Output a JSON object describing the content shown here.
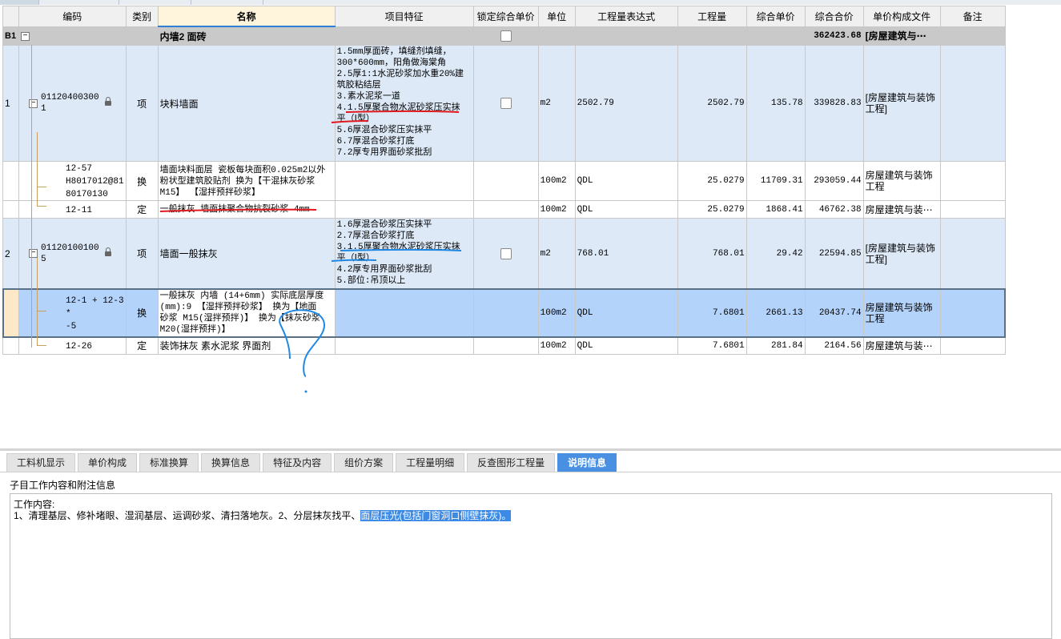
{
  "columns": {
    "code": "编码",
    "type": "类别",
    "name": "名称",
    "feature": "项目特征",
    "lock": "锁定综合单价",
    "unit": "单位",
    "expr": "工程量表达式",
    "qty": "工程量",
    "unit_price": "综合单价",
    "total": "综合合价",
    "file": "单价构成文件",
    "remark": "备注"
  },
  "group": {
    "id": "B1",
    "name": "内墙2  面砖",
    "total": "362423.68",
    "file": "[房屋建筑与⋯"
  },
  "row1": {
    "index": "1",
    "code_l1": "01120400300",
    "code_l2": "1",
    "type": "项",
    "name": "块料墙面",
    "feature": [
      "1.5mm厚面砖，填缝剂填缝，",
      "300*600mm，阳角做海棠角",
      "2.5厚1:1水泥砂浆加水重20%建",
      "筑胶粘结层",
      "3.素水泥浆一道",
      "4.1.5厚聚合物水泥砂浆压实抹",
      "平（Ⅰ型）",
      "5.6厚混合砂浆压实抹平",
      "6.7厚混合砂浆打底",
      "7.2厚专用界面砂浆批刮"
    ],
    "unit": "m2",
    "expr": "2502.79",
    "qty": "2502.79",
    "unit_price": "135.78",
    "total": "339828.83",
    "file_l1": "[房屋建筑与装饰",
    "file_l2": "工程]"
  },
  "row1a": {
    "code_l1": "12-57",
    "code_l2": "H8017012@81",
    "code_l3": "80170130",
    "type": "换",
    "name_l1": "墙面块料面层 瓷板每块面积0.025m2以外",
    "name_l2": "粉状型建筑胶贴剂  换为【干混抹灰砂浆",
    "name_l3": "M15】  【湿拌预拌砂浆】",
    "unit": "100m2",
    "expr": "QDL",
    "qty": "25.0279",
    "unit_price": "11709.31",
    "total": "293059.44",
    "file_l1": "房屋建筑与装饰",
    "file_l2": "工程"
  },
  "row1b": {
    "code": "12-11",
    "type": "定",
    "name": "一般抹灰 墙面抹聚合物抗裂砂浆 4mm",
    "unit": "100m2",
    "expr": "QDL",
    "qty": "25.0279",
    "unit_price": "1868.41",
    "total": "46762.38",
    "file": "房屋建筑与装⋯"
  },
  "row2": {
    "index": "2",
    "code_l1": "01120100100",
    "code_l2": "5",
    "type": "项",
    "name": "墙面一般抹灰",
    "feature": [
      "1.6厚混合砂浆压实抹平",
      "2.7厚混合砂浆打底",
      "3.1.5厚聚合物水泥砂浆压实抹",
      "平（Ⅰ型）",
      "4.2厚专用界面砂浆批刮",
      "5.部位:吊顶以上"
    ],
    "unit": "m2",
    "expr": "768.01",
    "qty": "768.01",
    "unit_price": "29.42",
    "total": "22594.85",
    "file_l1": "[房屋建筑与装饰",
    "file_l2": "工程]"
  },
  "row2a": {
    "code_l1": "12-1 + 12-3 *",
    "code_l2": "-5",
    "type": "换",
    "name_l1": "一般抹灰 内墙 (14+6mm)  实际底层厚度",
    "name_l2": "(mm):9  【湿拌预拌砂浆】  换为【地面",
    "name_l3": "砂浆 M15(湿拌预拌)】  换为【抹灰砂浆",
    "name_l4": "M20(湿拌预拌)】",
    "unit": "100m2",
    "expr": "QDL",
    "qty": "7.6801",
    "unit_price": "2661.13",
    "total": "20437.74",
    "file_l1": "房屋建筑与装饰",
    "file_l2": "工程"
  },
  "row2b": {
    "code": "12-26",
    "type": "定",
    "name": "装饰抹灰 素水泥浆 界面剂",
    "unit": "100m2",
    "expr": "QDL",
    "qty": "7.6801",
    "unit_price": "281.84",
    "total": "2164.56",
    "file": "房屋建筑与装⋯"
  },
  "tabs": [
    "工料机显示",
    "单价构成",
    "标准换算",
    "换算信息",
    "特征及内容",
    "组价方案",
    "工程量明细",
    "反查图形工程量",
    "说明信息"
  ],
  "panel": {
    "title": "子目工作内容和附注信息",
    "label": "工作内容:",
    "text_plain": "1、清理基层、修补堵眼、湿润基层、运调砂浆、清扫落地灰。2、分层抹灰找平、",
    "text_highlight": "面层压光(包括门窗洞口侧壁抹灰)。"
  },
  "colors": {
    "item_row": "#dde9f7",
    "selected_row": "#b4d3fb",
    "group_row": "#c9c9c9",
    "active_tab": "#4a90e2",
    "red_mark": "#e0191e",
    "blue_mark": "#1e88e5"
  }
}
